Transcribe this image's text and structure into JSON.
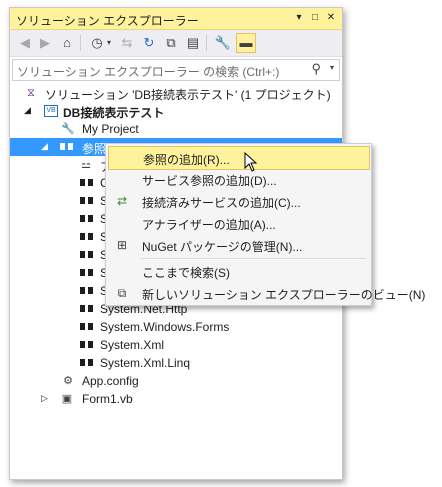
{
  "panel": {
    "title": "ソリューション エクスプローラー",
    "title_buttons": [
      "▾",
      "□",
      "✕"
    ],
    "search_placeholder": "ソリューション エクスプローラー の検索 (Ctrl+:)"
  },
  "tree": {
    "solution": "ソリューション 'DB接続表示テスト' (1 プロジェクト)",
    "project": "DB接続表示テスト",
    "my_project": "My Project",
    "references": "参照",
    "hidden_prefixes": [
      "ア",
      "C",
      "S",
      "S",
      "S",
      "S",
      "S",
      "S"
    ],
    "refs": [
      "System.Net.Http",
      "System.Windows.Forms",
      "System.Xml",
      "System.Xml.Linq"
    ],
    "app_config": "App.config",
    "form1": "Form1.vb"
  },
  "context_menu": {
    "items": [
      "参照の追加(R)...",
      "サービス参照の追加(D)...",
      "接続済みサービスの追加(C)...",
      "アナライザーの追加(A)...",
      "NuGet パッケージの管理(N)...",
      "ここまで検索(S)",
      "新しいソリューション エクスプローラーのビュー(N)"
    ]
  },
  "colors": {
    "title_bg": "#fff29d",
    "selection": "#3399ff",
    "menu_bg": "#f5f5f5"
  }
}
